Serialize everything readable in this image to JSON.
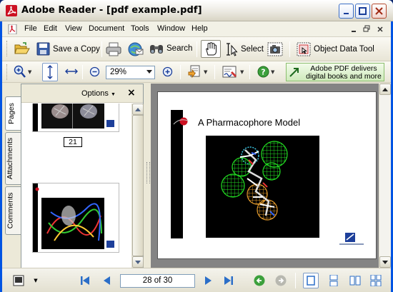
{
  "window": {
    "title": "Adobe Reader - [pdf example.pdf]"
  },
  "menu": {
    "items": [
      "File",
      "Edit",
      "View",
      "Document",
      "Tools",
      "Window",
      "Help"
    ]
  },
  "toolbar1": {
    "save_copy_label": "Save a Copy",
    "search_label": "Search",
    "select_label": "Select",
    "object_data_tool_label": "Object Data Tool"
  },
  "toolbar2": {
    "zoom_value": "29%",
    "ad_banner_text": "Adobe PDF delivers digital books and more"
  },
  "nav_panel": {
    "options_label": "Options",
    "tabs": [
      "Pages",
      "Attachments",
      "Comments"
    ],
    "thumbnail_page_number": "21"
  },
  "document": {
    "page_heading": "A Pharmacophore Model"
  },
  "statusbar": {
    "page_indicator": "28 of 30"
  },
  "colors": {
    "title_bar_border": "#0054e3",
    "close_button": "#b5492f",
    "ad_banner_bg": "#cfeabb",
    "doc_background": "#848484",
    "sphere_green": "#22dd22",
    "sphere_orange": "#e39a2c",
    "sphere_cyan": "#3bc8e6",
    "accent_red": "#cc1122"
  },
  "icons": [
    "adobe-reader-icon",
    "minimize-icon",
    "maximize-icon",
    "close-icon",
    "folder-open-icon",
    "save-disk-icon",
    "printer-icon",
    "email-icon",
    "binoculars-icon",
    "hand-tool-icon",
    "select-text-icon",
    "snapshot-camera-icon",
    "object-data-icon",
    "zoom-in-icon",
    "fit-page-icon",
    "fit-width-icon",
    "zoom-out-icon",
    "zoom-plus-icon",
    "create-pdf-icon",
    "sign-icon",
    "help-icon",
    "first-page-icon",
    "previous-page-icon",
    "next-page-icon",
    "last-page-icon",
    "go-back-icon",
    "go-forward-icon",
    "single-page-icon",
    "continuous-icon",
    "facing-icon",
    "continuous-facing-icon"
  ]
}
